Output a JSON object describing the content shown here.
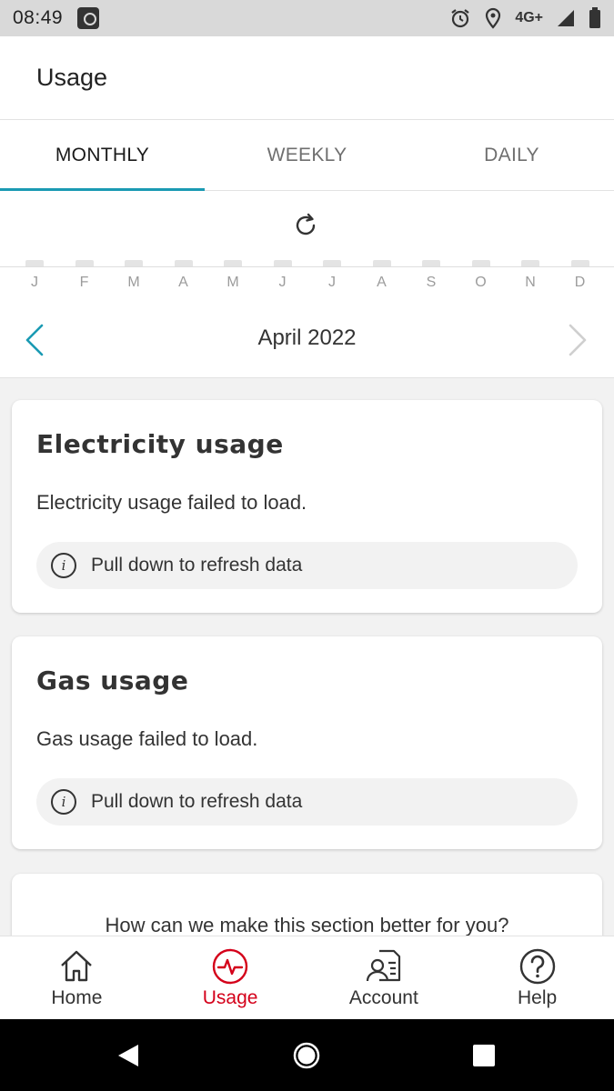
{
  "status": {
    "time": "08:49",
    "network": "4G+",
    "icons": [
      "notification-icon",
      "alarm-icon",
      "location-icon",
      "signal-icon",
      "battery-icon"
    ]
  },
  "appbar": {
    "title": "Usage"
  },
  "tabs": [
    {
      "label": "MONTHLY",
      "active": true
    },
    {
      "label": "WEEKLY",
      "active": false
    },
    {
      "label": "DAILY",
      "active": false
    }
  ],
  "chart": {
    "months": [
      "J",
      "F",
      "M",
      "A",
      "M",
      "J",
      "J",
      "A",
      "S",
      "O",
      "N",
      "D"
    ],
    "period": "April 2022"
  },
  "electricity": {
    "title": "Electricity usage",
    "message": "Electricity usage failed to load.",
    "hint": "Pull down to refresh data"
  },
  "gas": {
    "title": "Gas usage",
    "message": "Gas usage failed to load.",
    "hint": "Pull down to refresh data"
  },
  "feedback": {
    "question": "How can we make this section better for you?"
  },
  "bottom_nav": [
    {
      "label": "Home",
      "icon": "home-icon",
      "active": false
    },
    {
      "label": "Usage",
      "icon": "usage-pulse-icon",
      "active": true
    },
    {
      "label": "Account",
      "icon": "account-icon",
      "active": false
    },
    {
      "label": "Help",
      "icon": "help-icon",
      "active": false
    }
  ],
  "colors": {
    "accent": "#1a9ab3",
    "active_nav": "#d4001a",
    "text": "#333333"
  }
}
